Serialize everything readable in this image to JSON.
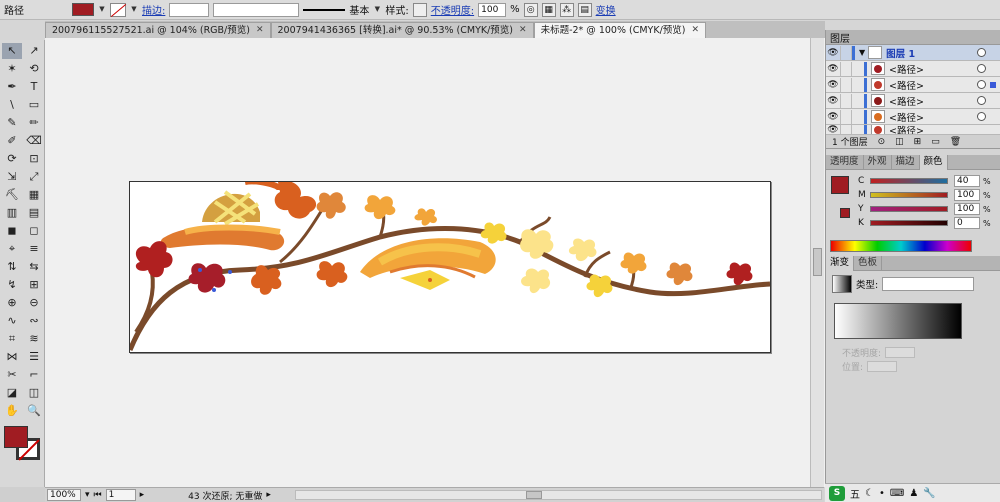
{
  "control_bar": {
    "object_type": "路径",
    "stroke_label": "描边:",
    "brush_label": "基本",
    "style_label": "样式:",
    "opacity_label": "不透明度:",
    "opacity_value": "100",
    "opacity_unit": "%",
    "transform_label": "变换",
    "fill_color": "#a01c22"
  },
  "tabs": [
    {
      "label": "200796115527521.ai @ 104% (RGB/预览)",
      "active": false
    },
    {
      "label": "2007941436365 [转换].ai* @ 90.53% (CMYK/预览)",
      "active": false
    },
    {
      "label": "未标题-2* @ 100% (CMYK/预览)",
      "active": true
    }
  ],
  "tools": [
    "↖",
    "↗",
    "✶",
    "⟲",
    "✒",
    "T",
    "\\",
    "▭",
    "✎",
    "✏",
    "✐",
    "⌫",
    "⟳",
    "⊡",
    "⇲",
    "⤢",
    "⛏",
    "▦",
    "▥",
    "▤",
    "◼",
    "◻",
    "⌖",
    "≡",
    "⇅",
    "⇆",
    "↯",
    "⊞",
    "⊕",
    "⊖",
    "∿",
    "∾",
    "⌗",
    "≋",
    "⋈",
    "☰",
    "✂",
    "⌐",
    "◪",
    "◫",
    "✋",
    "🔍"
  ],
  "status": {
    "zoom": "100%",
    "page": "1",
    "message": "43 次还原; 无重做"
  },
  "layers_panel": {
    "title": "图层",
    "layer_name": "图层 1",
    "rows": [
      "<路径>",
      "<路径>",
      "<路径>",
      "<路径>",
      "<路径>"
    ],
    "footer": "1 个图层"
  },
  "color_panel": {
    "tabs": [
      "透明度",
      "外观",
      "描边",
      "颜色"
    ],
    "channels": [
      {
        "name": "C",
        "value": "40"
      },
      {
        "name": "M",
        "value": "100"
      },
      {
        "name": "Y",
        "value": "100"
      },
      {
        "name": "K",
        "value": "0"
      }
    ],
    "unit": "%"
  },
  "gradient_panel": {
    "tabs": [
      "渐变",
      "色板"
    ],
    "type_label": "类型:",
    "opacity_label": "不透明度:",
    "location_label": "位置:"
  },
  "taskbar": {
    "ime": "五"
  }
}
